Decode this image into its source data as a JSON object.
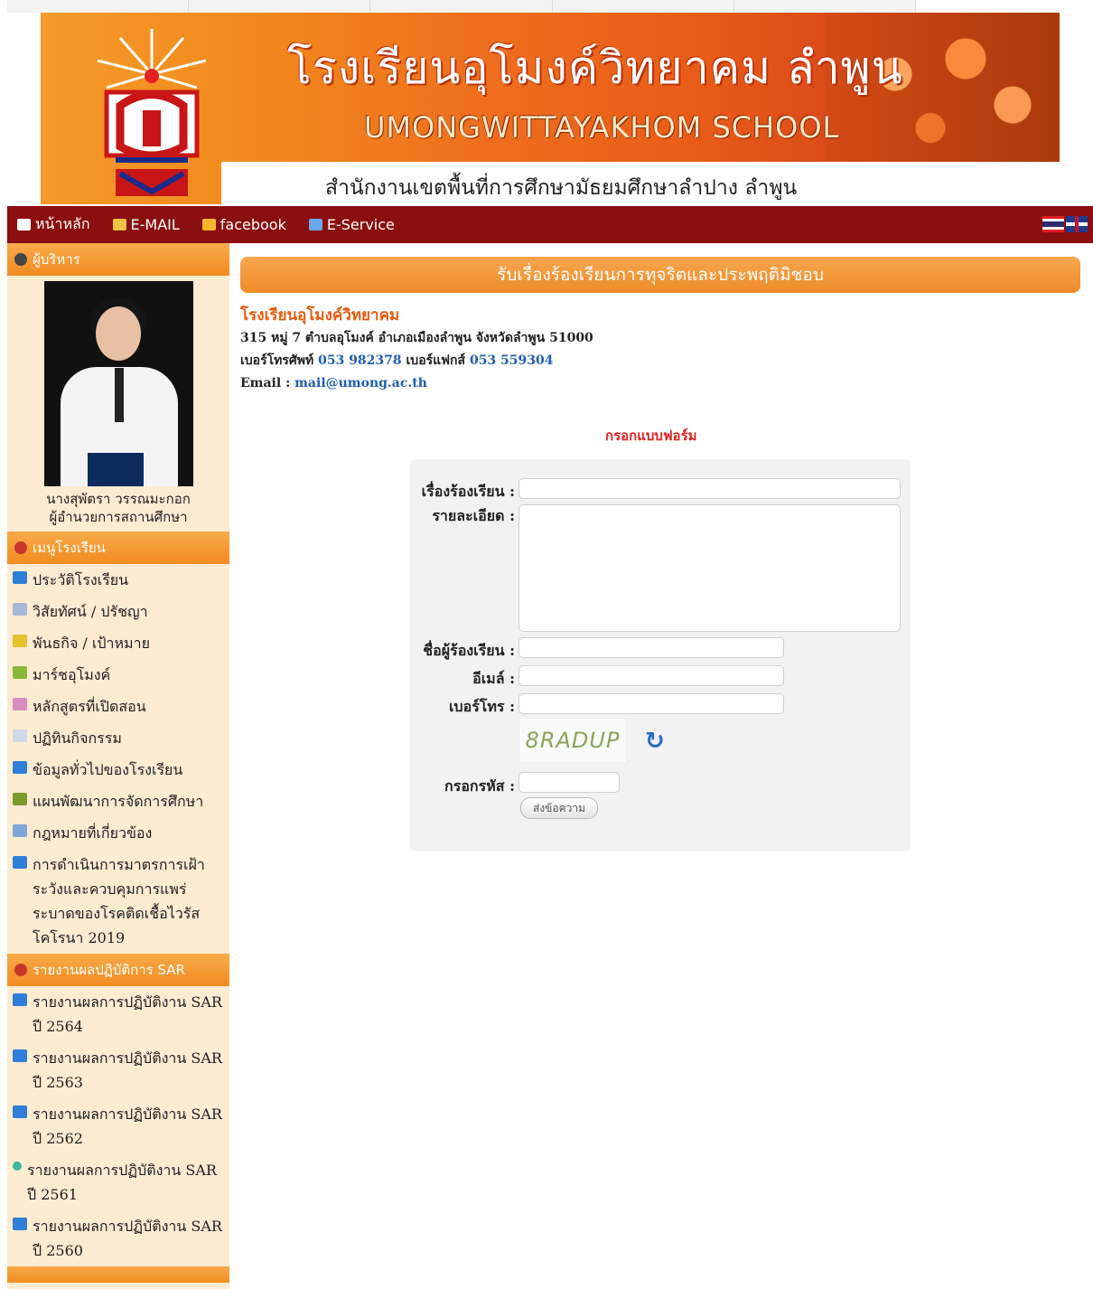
{
  "header": {
    "title_th": "โรงเรียนอุโมงค์วิทยาคม ลำพูน",
    "title_en": "UMONGWITTAYAKHOM SCHOOL",
    "subtitle": "สำนักงานเขตพื้นที่การศึกษามัธยมศึกษาลำปาง ลำพูน"
  },
  "nav": {
    "items": [
      {
        "label": "หน้าหลัก",
        "icon": "home-icon"
      },
      {
        "label": "E-MAIL",
        "icon": "mail-icon"
      },
      {
        "label": "facebook",
        "icon": "facebook-icon"
      },
      {
        "label": "E-Service",
        "icon": "users-icon"
      }
    ]
  },
  "sidebar": {
    "admin_header": "ผู้บริหาร",
    "admin_name": "นางสุพัตรา วรรณมะกอก",
    "admin_position": "ผู้อำนวยการสถานศึกษา",
    "menu_header": "เมนูโรงเรียน",
    "menu_items": [
      "ประวัติโรงเรียน",
      "วิสัยทัศน์ / ปรัชญา",
      "พันธกิจ / เป้าหมาย",
      "มาร์ชอุโมงค์",
      "หลักสูตรที่เปิดสอน",
      "ปฏิทินกิจกรรม",
      "ข้อมูลทั่วไปของโรงเรียน",
      "แผนพัฒนาการจัดการศึกษา",
      "กฎหมายที่เกี่ยวข้อง",
      "การดำเนินการมาตรการเฝ้าระวังและควบคุมการแพร่ระบาดของโรคติดเชื้อไวรัสโคโรนา 2019"
    ],
    "sar_header": "รายงานผลปฏิบัติการ SAR",
    "sar_items": [
      "รายงานผลการปฏิบัติงาน SAR ปี 2564",
      "รายงานผลการปฏิบัติงาน SAR ปี 2563",
      "รายงานผลการปฏิบัติงาน SAR ปี 2562",
      "รายงานผลการปฏิบัติงาน SAR ปี 2561",
      "รายงานผลการปฏิบัติงาน SAR ปี 2560"
    ]
  },
  "main": {
    "page_title": "รับเรื่องร้องเรียนการทุจริตและประพฤติมิชอบ",
    "school_name": "โรงเรียนอุโมงค์วิทยาคม",
    "address": "315 หมู่ 7  ตำบลอุโมงค์ อำเภอเมืองลำพูน จังหวัดลำพูน 51000",
    "phone_label": "เบอร์โทรศัพท์",
    "phone": "053 982378",
    "fax_label": "เบอร์แฟกส์",
    "fax": "053 559304",
    "email_label": "Email :",
    "email": "mail@umong.ac.th"
  },
  "form": {
    "heading": "กรอกแบบฟอร์ม",
    "subject_label": "เรื่องร้องเรียน :",
    "detail_label": "รายละเอียด :",
    "name_label": "ชื่อผู้ร้องเรียน :",
    "email_label": "อีเมล์ :",
    "phone_label": "เบอร์โทร :",
    "captcha_text": "8RADUP",
    "code_label": "กรอกรหัส :",
    "submit_label": "ส่งข้อความ"
  }
}
